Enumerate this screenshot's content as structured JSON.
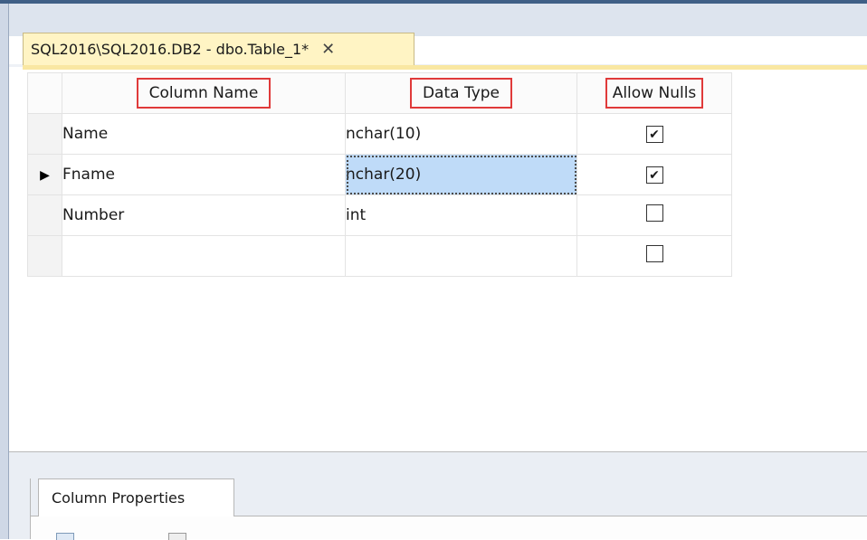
{
  "document_tab": {
    "title": "SQL2016\\SQL2016.DB2 - dbo.Table_1*",
    "close_glyph": "✕"
  },
  "grid": {
    "headers": {
      "column_name": "Column Name",
      "data_type": "Data Type",
      "allow_nulls": "Allow Nulls"
    },
    "rows": [
      {
        "name": "Name",
        "type": "nchar(10)",
        "allow_nulls": true,
        "current": false
      },
      {
        "name": "Fname",
        "type": "nchar(20)",
        "allow_nulls": true,
        "current": true
      },
      {
        "name": "Number",
        "type": "int",
        "allow_nulls": false,
        "current": false
      },
      {
        "name": "",
        "type": "",
        "allow_nulls": false,
        "current": false
      }
    ],
    "current_row_marker": "▶",
    "check_glyph": "✔"
  },
  "lower_panel": {
    "tab_label": "Column Properties"
  },
  "colors": {
    "tab_background": "#fff4c4",
    "selection": "#bfdbf8",
    "highlight_box": "#e03a3a"
  }
}
